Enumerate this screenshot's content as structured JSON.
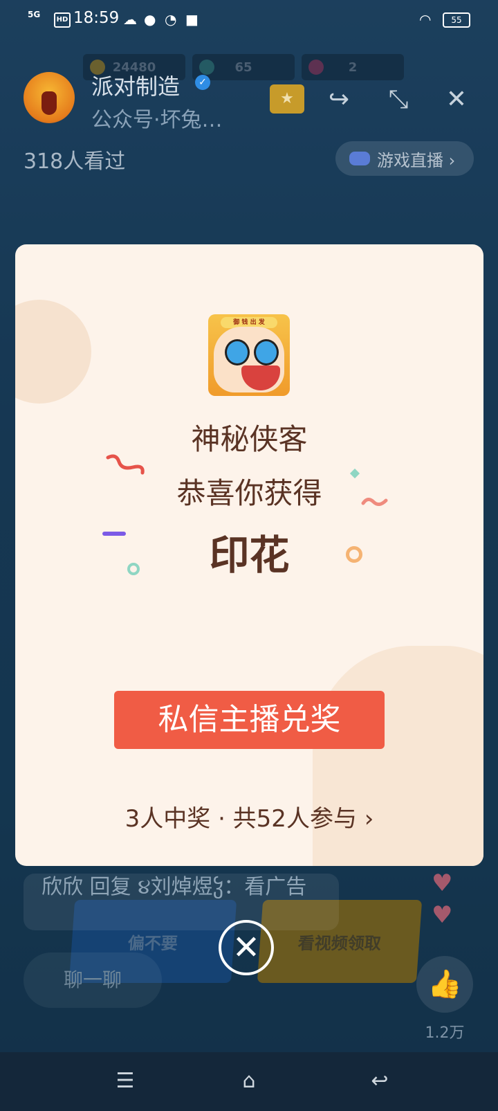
{
  "status_bar": {
    "network": "5G",
    "hd": "HD",
    "time": "18:59",
    "battery": "55"
  },
  "game_stats": {
    "coins": "24480",
    "gems": "65",
    "tickets": "2"
  },
  "game_buttons": {
    "refuse": "偏不要",
    "watch_video": "看视频领取"
  },
  "live_header": {
    "name": "派对制造",
    "subtitle": "公众号·坏兔…",
    "viewers": "318人看过",
    "game_live": "游戏直播 ›"
  },
  "prize_modal": {
    "game_name": "神秘侠客",
    "congrats": "恭喜你获得",
    "prize": "印花",
    "app_tag": "御 钱 出 发",
    "claim_button": "私信主播兑奖",
    "winners_summary": "3人中奖 · 共52人参与 ›"
  },
  "chat": {
    "message": "欣欣 回复 ૪刘焯煜ჴ：看广告",
    "chat_button": "聊一聊"
  },
  "like": {
    "count": "1.2万"
  },
  "colors": {
    "modal_bg": "#fdf3ea",
    "claim_button": "#f05c45",
    "title_text": "#5a3324"
  },
  "icons": {
    "share": "share-icon",
    "minimize": "minimize-icon",
    "close": "close-icon",
    "like": "thumbs-up-icon"
  }
}
